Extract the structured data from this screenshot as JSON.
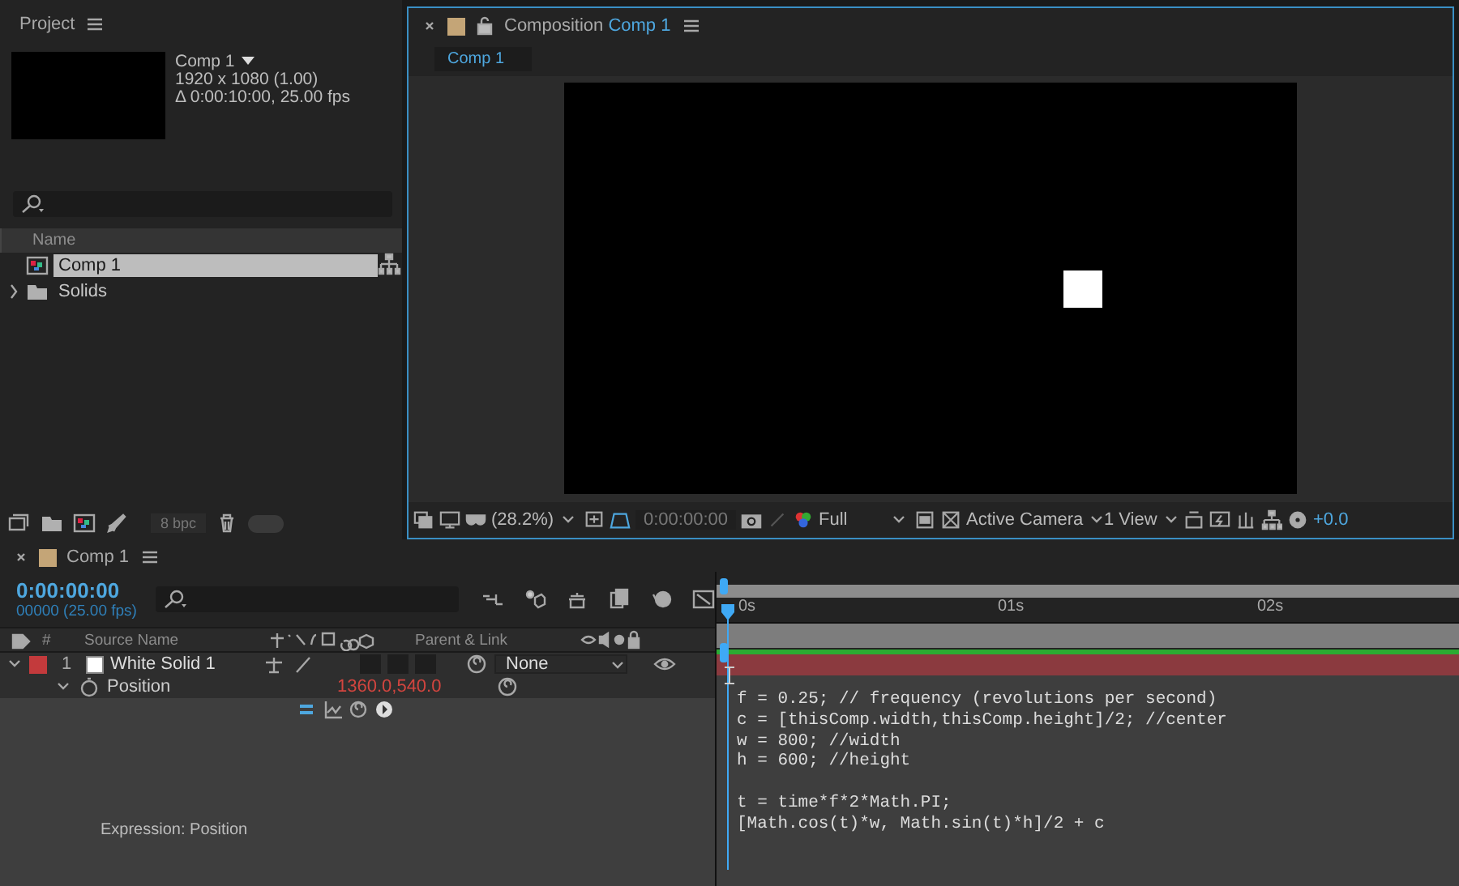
{
  "project": {
    "title": "Project",
    "comp_info": {
      "name": "Comp 1",
      "dimensions": "1920 x 1080 (1.00)",
      "duration": "Δ 0:00:10:00, 25.00 fps"
    },
    "column": "Name",
    "items": [
      {
        "name": "Comp 1",
        "kind": "comp",
        "selected": true
      },
      {
        "name": "Solids",
        "kind": "folder",
        "selected": false
      }
    ],
    "bit_depth": "8 bpc"
  },
  "viewer": {
    "tab_label": "Composition",
    "tab_comp": "Comp 1",
    "flow_tab": "Comp 1",
    "zoom": "(28.2%)",
    "time": "0:00:00:00",
    "resolution": "Full",
    "camera": "Active Camera",
    "views": "1 View",
    "exposure": "+0.0"
  },
  "timeline": {
    "tab": "Comp 1",
    "timecode": "0:00:00:00",
    "frames": "00000 (25.00 fps)",
    "columns": {
      "number": "#",
      "source": "Source Name",
      "parent": "Parent & Link"
    },
    "layers": [
      {
        "number": "1",
        "name": "White Solid 1",
        "color": "#c33a3c",
        "expanded": true,
        "parent": "None",
        "property": "Position",
        "value": "1360.0,540.0"
      }
    ],
    "ruler": [
      "0s",
      "01s",
      "02s"
    ],
    "expression_label": "Expression: Position",
    "expression": [
      [
        "f = 0.25; // frequency (revolutions per second)",
        "c = [thisComp.width,thisComp.height]/2; //center",
        "w = 800; //width",
        "h = 600; //height"
      ],
      [
        "t = time*f*2*Math.PI;",
        "[Math.cos(t)*w, Math.sin(t)*h]/2 + c"
      ]
    ]
  }
}
